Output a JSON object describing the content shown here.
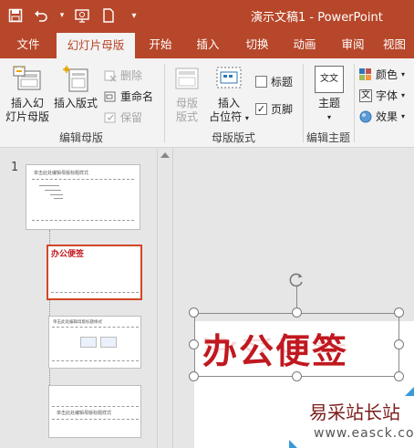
{
  "title": "演示文稿1 - PowerPoint",
  "qat": {
    "save": "save-icon",
    "undo": "undo-icon",
    "undo_arrow": "▾",
    "slideshow": "slideshow-icon",
    "new": "new-icon",
    "customize": "▾"
  },
  "tabs": [
    "文件",
    "幻灯片母版",
    "开始",
    "插入",
    "切换",
    "动画",
    "审阅",
    "视图"
  ],
  "ribbon": {
    "edit_master": {
      "label": "编辑母版",
      "insert_master_l1": "插入幻",
      "insert_master_l2": "灯片母版",
      "insert_layout": "插入版式",
      "delete": "删除",
      "rename": "重命名",
      "preserve": "保留"
    },
    "master_layout": {
      "label": "母版版式",
      "master_layout_l1": "母版",
      "master_layout_l2": "版式",
      "insert_placeholder_l1": "插入",
      "insert_placeholder_l2": "占位符",
      "title_cb": "标题",
      "footer_cb": "页脚",
      "footer_checked": "✓"
    },
    "edit_theme": {
      "label": "编辑主题",
      "theme": "主题",
      "theme_icon_text": "文文"
    },
    "background": {
      "colors": "颜色",
      "fonts": "字体",
      "effects": "效果"
    }
  },
  "slide_pane": {
    "number": "1",
    "master_title": "单击此处编辑母版标题样式",
    "layout2_title": "办公便签"
  },
  "slide": {
    "title_art": "办公便签"
  },
  "watermark": {
    "cn": "易采站长站",
    "url": "www.easck.com"
  },
  "colors": {
    "accent": "#b7472a",
    "selection": "#d24726",
    "title_red": "#c0181f"
  }
}
